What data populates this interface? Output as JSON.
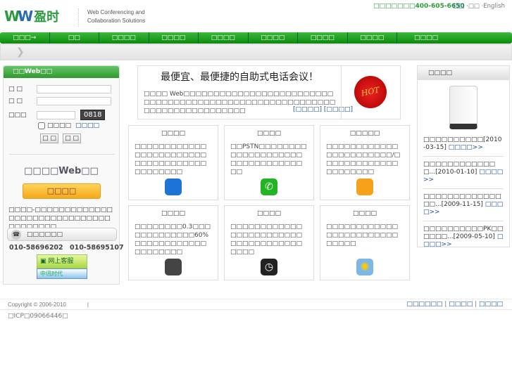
{
  "header": {
    "logo_text": "盈时",
    "tagline_1": "Web Conferencing and",
    "tagline_2": "Collaboration Solutions",
    "hotline": "□□□□□□□400-605-6650",
    "lang_1": "·□□",
    "lang_2": "·□□",
    "lang_3": "·English"
  },
  "nav": [
    "□□□→",
    "□□",
    "□□□□",
    "□□□□",
    "□□□□",
    "□□□□",
    "□□□□",
    "□□□□",
    "□□□□"
  ],
  "login": {
    "title": "□□Web□□",
    "user_label": "□ □",
    "pass_label": "□ □",
    "captcha_label": "□□□",
    "captcha_value": "0818",
    "remember": "□□□□",
    "forgot": "□□□□",
    "submit": "□ □",
    "reset": "□ □",
    "promo_title": "□□□□Web□□",
    "promo_button": "□□□□",
    "promo_desc": "□□□□-□□□□□□□□□□□□□□□□□□□□□□□□□□□□□□□□□□□□□□",
    "hotline_title": "□□□□□□",
    "phone_1": "010-58696202",
    "phone_2": "010-58695107",
    "online_service": "网上客服",
    "partner": "中讯时代"
  },
  "banner": {
    "headline": "最便宜、最便捷的自助式电话会议！",
    "body": "□□□□ Web□□□□□□□□□□□□□□□□□□□□□□□□□□□□□□□□□□□□□□□□□□□□□□□□□□□□□□□□□□□□□□□□□□□□□□□□□□",
    "link_1": "[□□□□]",
    "link_2": "[□□□□]",
    "badge": "HOT"
  },
  "features": [
    {
      "title": "□□□□",
      "desc": "□□□□□□□□□□□□□□□□□□□□□□□□□□□□□□□□□□□□□□□□□□□□",
      "icon": "phone-transfer-icon",
      "color": "#1e73d6"
    },
    {
      "title": "□□□□",
      "desc": "□□PSTN□□□□□□□□□□□□□□□□□□□□□□□□□□□□□□□□□□",
      "icon": "phone-icon",
      "color": "#22b422"
    },
    {
      "title": "□□□□□",
      "desc": "□□□□□□□□□□□□□□□□□□□□□□□/□□□□□□□□□□□□□□□□□□□□□",
      "icon": "ipod-icon",
      "color": "#f5a21a"
    },
    {
      "title": "□□□□",
      "desc": "□□□□□□□□0.3□□□□□□□□□□□□□60%□□□□□□□□□□□□□□□□□□□□",
      "icon": "calculator-icon",
      "color": "#444"
    },
    {
      "title": "□□□□",
      "desc": "□□□□□□□□□□□□□□□□□□□□□□□□□□□□□□□□□□□□□□□□",
      "icon": "clock-icon",
      "color": "#222"
    },
    {
      "title": "□□□□",
      "desc": "□□□□□□□□□□□□□□□□□□□□□□□□□□□□□",
      "icon": "sunflower-icon",
      "color": "#7cb7e8"
    }
  ],
  "news": {
    "title": "□□□□",
    "items": [
      {
        "text": "□□□□□□□□□□[2010-03-15]",
        "more": "□□□□>>"
      },
      {
        "text": "□□□□□□□□□□□□□...[2010-01-10]",
        "more": "□□□□>>"
      },
      {
        "text": "□□□□□□□□□□□□□□□...[2009-11-15]",
        "more": "□□□□>>"
      },
      {
        "text": "□□□□□□□□□□PK□□□□□□...[2009-05-10]",
        "more": "□□□□>>"
      }
    ]
  },
  "footer": {
    "copyright": "Copyright © 2006-2010",
    "sep": "|",
    "links": [
      "□□□□□□",
      "□□□□",
      "□□□□"
    ],
    "icp": "□ICP□09066446□"
  }
}
